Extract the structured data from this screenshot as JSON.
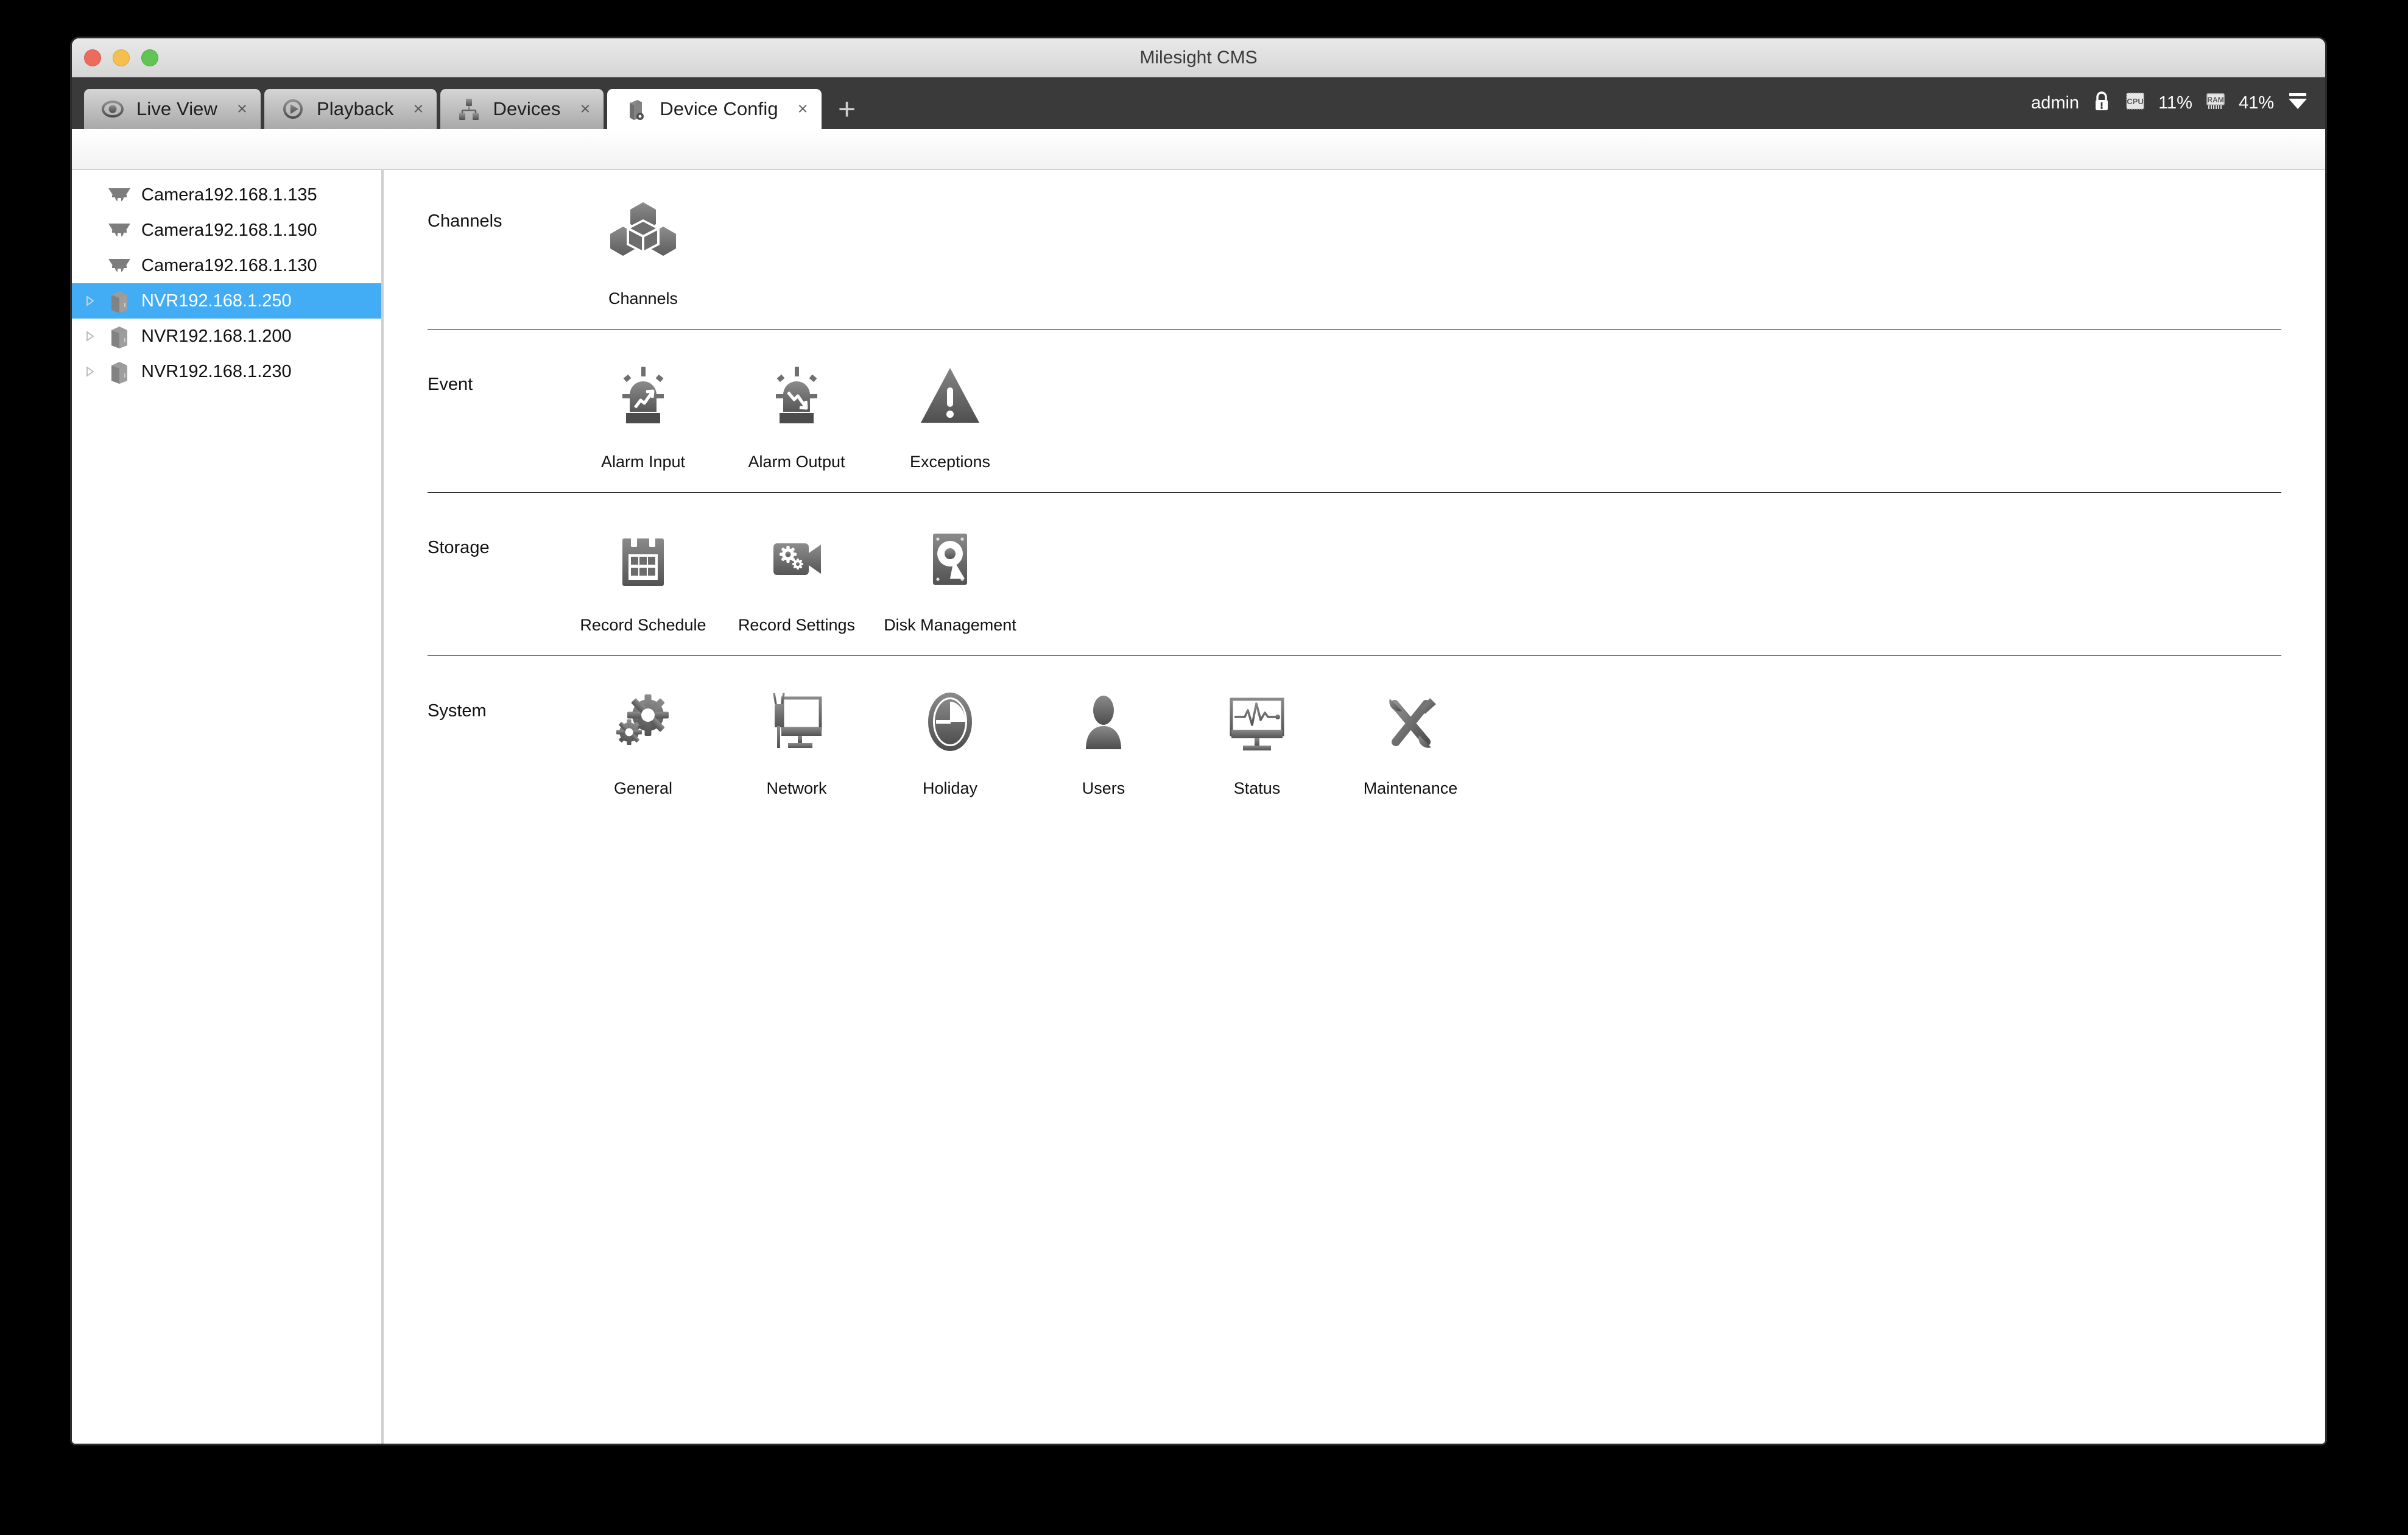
{
  "window": {
    "title": "Milesight CMS",
    "traffic_lights": [
      "close",
      "minimize",
      "zoom"
    ]
  },
  "tabs": [
    {
      "label": "Live View",
      "icon": "eye-icon",
      "close": "×",
      "active": false
    },
    {
      "label": "Playback",
      "icon": "play-circle-icon",
      "close": "×",
      "active": false
    },
    {
      "label": "Devices",
      "icon": "devices-icon",
      "close": "×",
      "active": false
    },
    {
      "label": "Device Config",
      "icon": "device-config-icon",
      "close": "×",
      "active": true
    }
  ],
  "new_tab_label": "+",
  "status": {
    "user": "admin",
    "lock_icon": "lock-icon",
    "cpu_label": "CPU",
    "cpu_value": "11%",
    "ram_label": "RAM",
    "ram_value": "41%",
    "menu_icon": "dropdown-triangle-icon"
  },
  "sidebar": {
    "items": [
      {
        "label": "Camera192.168.1.135",
        "type": "camera",
        "expandable": false,
        "selected": false
      },
      {
        "label": "Camera192.168.1.190",
        "type": "camera",
        "expandable": false,
        "selected": false
      },
      {
        "label": "Camera192.168.1.130",
        "type": "camera",
        "expandable": false,
        "selected": false
      },
      {
        "label": "NVR192.168.1.250",
        "type": "nvr",
        "expandable": true,
        "selected": true
      },
      {
        "label": "NVR192.168.1.200",
        "type": "nvr",
        "expandable": true,
        "selected": false
      },
      {
        "label": "NVR192.168.1.230",
        "type": "nvr",
        "expandable": true,
        "selected": false
      }
    ]
  },
  "sections": [
    {
      "label": "Channels",
      "tiles": [
        {
          "label": "Channels",
          "icon": "channels-cubes-icon"
        }
      ]
    },
    {
      "label": "Event",
      "tiles": [
        {
          "label": "Alarm Input",
          "icon": "alarm-input-siren-icon"
        },
        {
          "label": "Alarm Output",
          "icon": "alarm-output-siren-icon"
        },
        {
          "label": "Exceptions",
          "icon": "warning-triangle-icon"
        }
      ]
    },
    {
      "label": "Storage",
      "tiles": [
        {
          "label": "Record Schedule",
          "icon": "calendar-icon"
        },
        {
          "label": "Record Settings",
          "icon": "camcorder-gear-icon"
        },
        {
          "label": "Disk Management",
          "icon": "hard-disk-icon"
        }
      ]
    },
    {
      "label": "System",
      "tiles": [
        {
          "label": "General",
          "icon": "gears-icon"
        },
        {
          "label": "Network",
          "icon": "network-monitor-icon"
        },
        {
          "label": "Holiday",
          "icon": "clock-icon"
        },
        {
          "label": "Users",
          "icon": "user-icon"
        },
        {
          "label": "Status",
          "icon": "status-monitor-icon"
        },
        {
          "label": "Maintenance",
          "icon": "tools-icon"
        }
      ]
    }
  ],
  "colors": {
    "selection_blue": "#42adf5",
    "tabbar_dark": "#3a3a3a",
    "icon_gray_light": "#8a8a8a",
    "icon_gray_dark": "#4a4a4a",
    "divider": "#2c2c2c"
  }
}
